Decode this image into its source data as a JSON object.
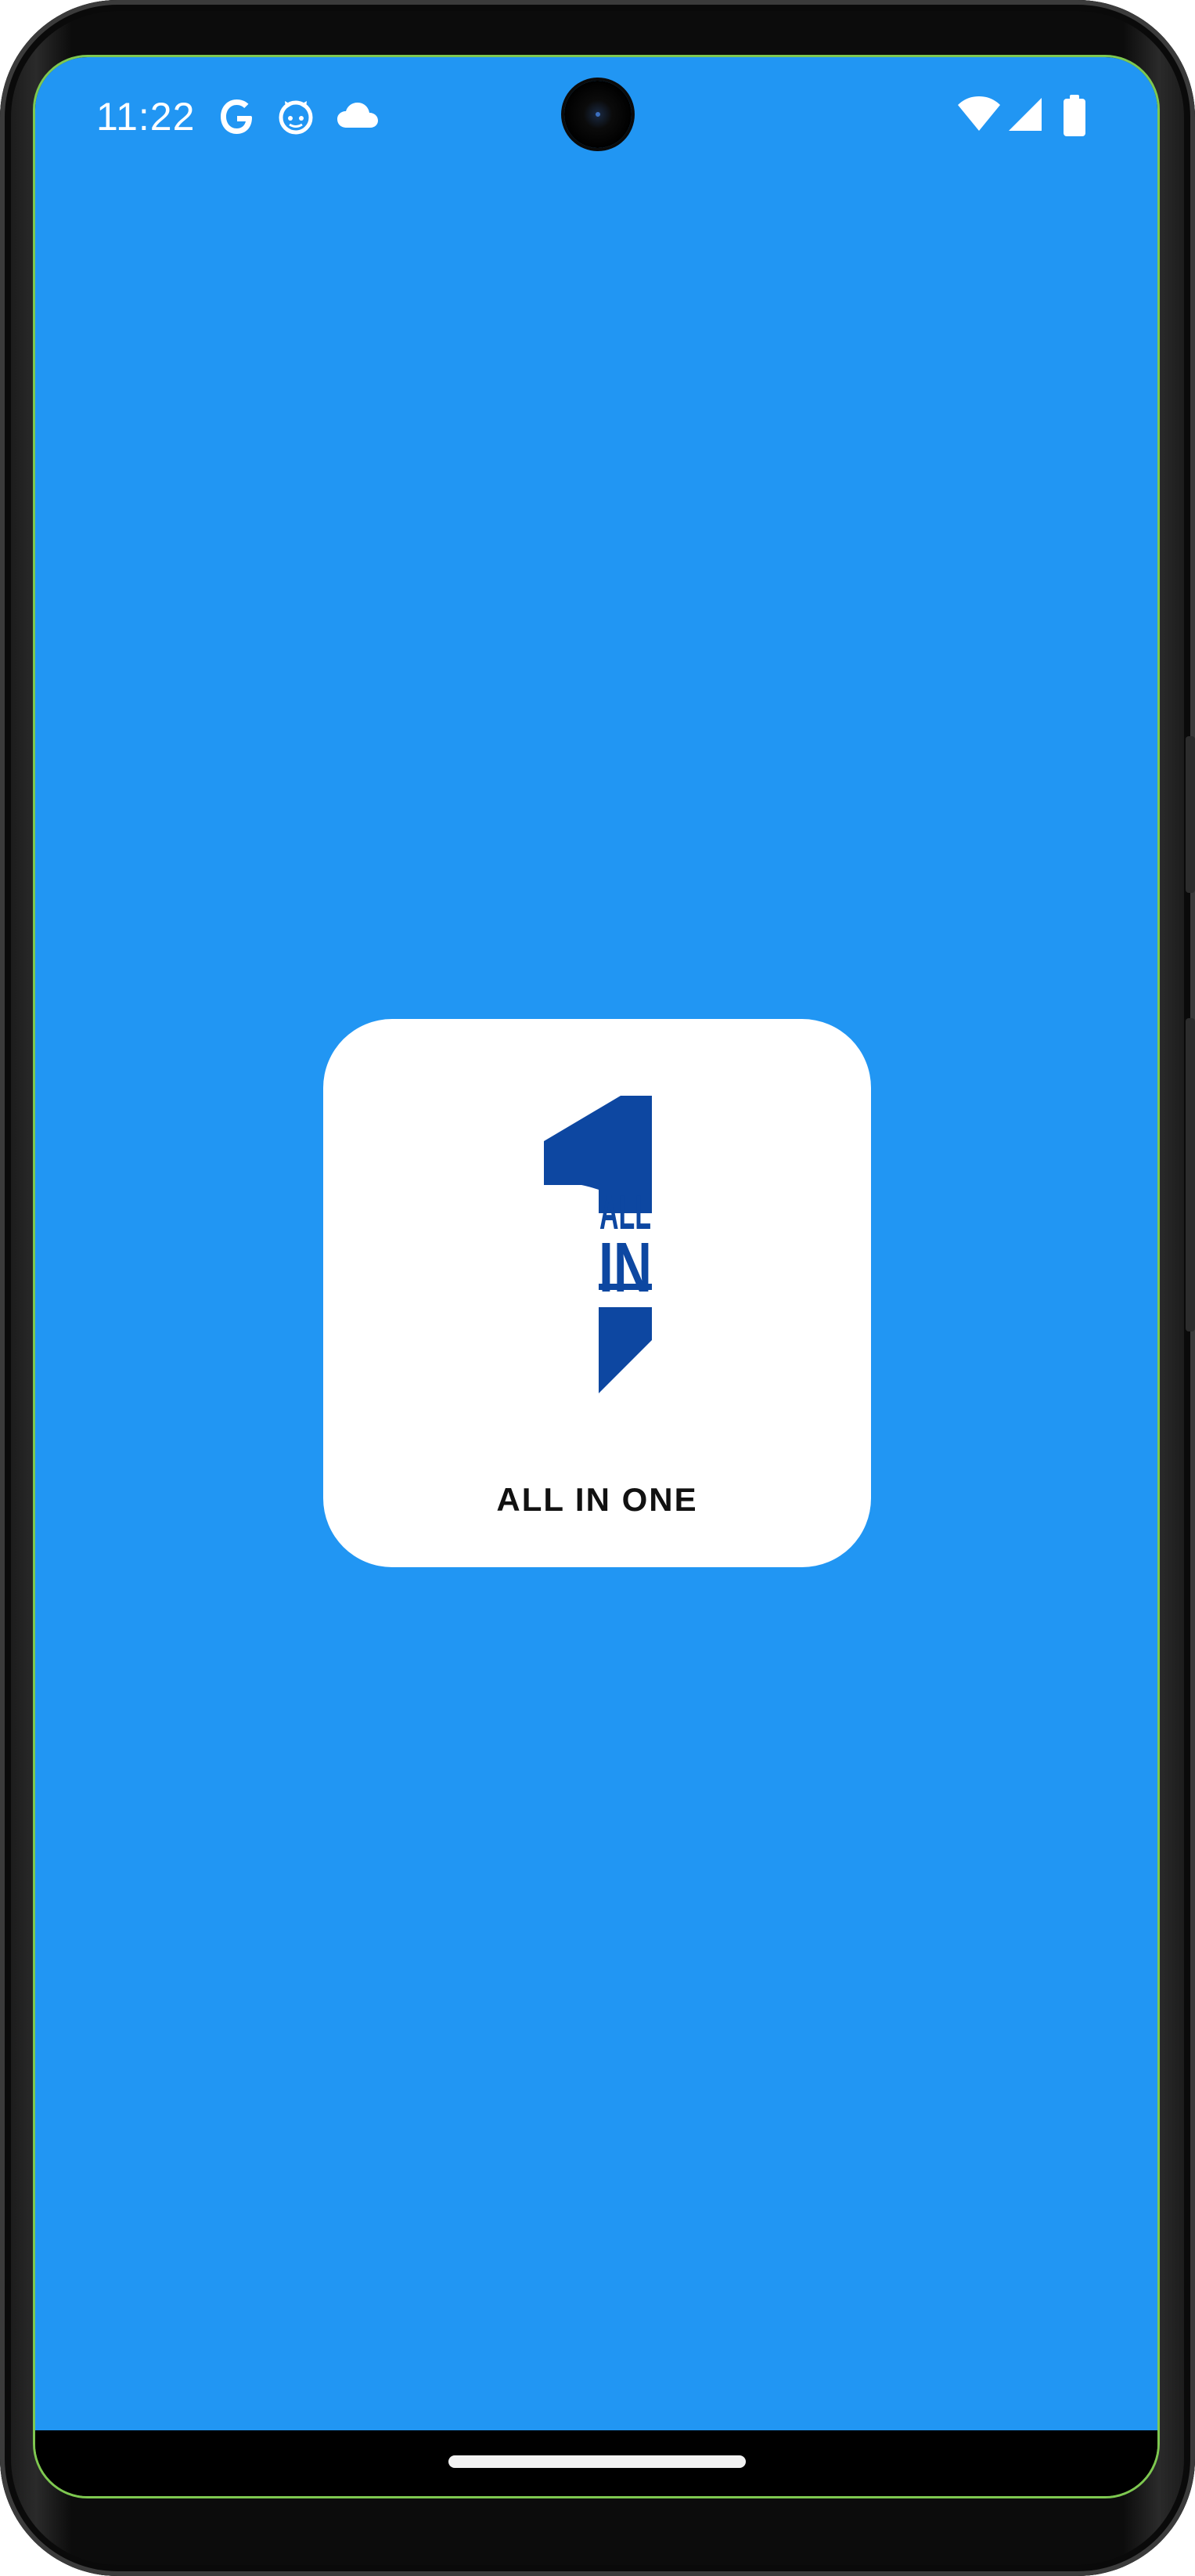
{
  "status_bar": {
    "time": "11:22",
    "icons": [
      "google-icon",
      "octocat-icon",
      "cloud-icon",
      "wifi-icon",
      "cell-signal-icon",
      "battery-icon"
    ]
  },
  "splash": {
    "background_color": "#2196f3",
    "logo": {
      "mark_text_line1": "ALL",
      "mark_text_line2": "IN",
      "caption": "ALL IN ONE",
      "mark_color": "#0d47a1"
    }
  },
  "nav_bar": {
    "gesture": "home-pill"
  }
}
